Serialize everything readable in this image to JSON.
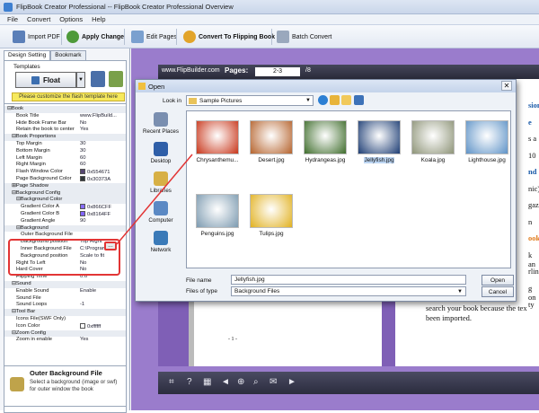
{
  "window": {
    "title": "FlipBook Creator Professional -- FlipBook Creator Professional Overview"
  },
  "menu": [
    "File",
    "Convert",
    "Options",
    "Help"
  ],
  "toolbar": {
    "import": "Import PDF",
    "apply": "Apply Change",
    "edit": "Edit Pages",
    "convert": "Convert To Flipping Book",
    "batch": "Batch Convert"
  },
  "left": {
    "tabs": [
      "Design Setting",
      "Bookmark"
    ],
    "templates_label": "Templates",
    "template_name": "Float",
    "customize_hint": "Please customize the flash template here"
  },
  "props": [
    {
      "k": "⊟Book",
      "v": "",
      "cat": true,
      "ind": 0
    },
    {
      "k": "Book Title",
      "v": "www.FlipBuild...",
      "ind": 2
    },
    {
      "k": "Hide Book Frame Bar",
      "v": "No",
      "ind": 2
    },
    {
      "k": "Retain the book to center",
      "v": "Yes",
      "ind": 2
    },
    {
      "k": "⊟Book Proportions",
      "v": "",
      "cat": true,
      "ind": 1
    },
    {
      "k": "Top Margin",
      "v": "30",
      "ind": 2
    },
    {
      "k": "Bottom Margin",
      "v": "30",
      "ind": 2
    },
    {
      "k": "Left Margin",
      "v": "60",
      "ind": 2
    },
    {
      "k": "Right Margin",
      "v": "60",
      "ind": 2
    },
    {
      "k": "Flash Window Color",
      "v": "0x554671",
      "sw": "#554671",
      "ind": 2
    },
    {
      "k": "Page Background Color",
      "v": "0x30373A",
      "sw": "#30373a",
      "ind": 2
    },
    {
      "k": "⊞Page Shadow",
      "v": "",
      "cat": true,
      "ind": 1
    },
    {
      "k": "⊟Background Config",
      "v": "",
      "cat": true,
      "ind": 1
    },
    {
      "k": "⊟Background Color",
      "v": "",
      "cat": true,
      "ind": 2
    },
    {
      "k": "Gradient Color A",
      "v": "0x866CFF",
      "sw": "#866cff",
      "ind": 3
    },
    {
      "k": "Gradient Color B",
      "v": "0x8164FF",
      "sw": "#8164ff",
      "ind": 3
    },
    {
      "k": "Gradient Angle",
      "v": "90",
      "ind": 3
    },
    {
      "k": "⊟Background",
      "v": "",
      "cat": true,
      "ind": 2
    },
    {
      "k": "Outer Background File",
      "v": "",
      "ind": 3
    },
    {
      "k": "Background position",
      "v": "Top Right",
      "ind": 3
    },
    {
      "k": "Inner Background File",
      "v": "C:\\Program ...",
      "ind": 3
    },
    {
      "k": "Background position",
      "v": "Scale to fit",
      "ind": 3
    },
    {
      "k": "Right To Left",
      "v": "No",
      "ind": 2
    },
    {
      "k": "Hard Cover",
      "v": "No",
      "ind": 2
    },
    {
      "k": "Flipping Time",
      "v": "0.6",
      "ind": 2
    },
    {
      "k": "⊟Sound",
      "v": "",
      "cat": true,
      "ind": 1
    },
    {
      "k": "Enable Sound",
      "v": "Enable",
      "ind": 2
    },
    {
      "k": "Sound File",
      "v": "",
      "ind": 2
    },
    {
      "k": "Sound Loops",
      "v": "-1",
      "ind": 2
    },
    {
      "k": "⊟Tool Bar",
      "v": "",
      "cat": true,
      "ind": 1
    },
    {
      "k": "Icons File(SWF Only)",
      "v": "",
      "ind": 2
    },
    {
      "k": "Icon Color",
      "v": "0xffffff",
      "sw": "#ffffff",
      "ind": 2
    },
    {
      "k": "⊟Zoom Config",
      "v": "",
      "cat": true,
      "ind": 1
    },
    {
      "k": "Zoom in enable",
      "v": "Yes",
      "ind": 2
    }
  ],
  "desc": {
    "title": "Outer Background File",
    "text": "Select a background (image or swf) for outer window the book"
  },
  "book": {
    "site": "www.FlipBuilder.com",
    "pages_label": "Pages:",
    "pages_value": "2-3",
    "total": "/8",
    "left_page_num": "- 1 -",
    "right_text_lines": [
      {
        "t": "sion",
        "c": "#1a5aa8"
      },
      {
        "t": "e",
        "c": "#1a5aa8"
      },
      {
        "t": "s a",
        "c": "#111"
      },
      {
        "t": "10",
        "c": "#111"
      },
      {
        "t": "nd",
        "c": "#1a5aa8"
      },
      {
        "t": "nic)",
        "c": "#111"
      },
      {
        "t": "gazi",
        "c": "#111"
      },
      {
        "t": "n",
        "c": "#111"
      },
      {
        "t": "ook",
        "c": "#e07a1a"
      },
      {
        "t": "k an",
        "c": "#111"
      },
      {
        "t": "rlin",
        "c": "#111"
      },
      {
        "t": "g on",
        "c": "#111"
      },
      {
        "t": "ty",
        "c": "#111"
      },
      {
        "t": "search your book because the tex",
        "c": "#111"
      },
      {
        "t": "been imported.",
        "c": "#111"
      }
    ]
  },
  "dialog": {
    "title": "Open",
    "look_in_label": "Look in",
    "look_in_value": "Sample Pictures",
    "places": [
      "Recent Places",
      "Desktop",
      "Libraries",
      "Computer",
      "Network"
    ],
    "files": [
      {
        "name": "Chrysanthemu...",
        "color": "#c8361a",
        "sel": false
      },
      {
        "name": "Desert.jpg",
        "color": "#b5632d",
        "sel": false
      },
      {
        "name": "Hydrangeas.jpg",
        "color": "#3f6d2c",
        "sel": false
      },
      {
        "name": "Jellyfish.jpg",
        "color": "#1d3d74",
        "sel": true
      },
      {
        "name": "Koala.jpg",
        "color": "#8e9478",
        "sel": false
      },
      {
        "name": "Lighthouse.jpg",
        "color": "#5f93c7",
        "sel": false
      },
      {
        "name": "Penguins.jpg",
        "color": "#7c9ab0",
        "sel": false
      },
      {
        "name": "Tulips.jpg",
        "color": "#e1b120",
        "sel": false
      }
    ],
    "file_name_label": "File name",
    "file_name_value": "Jellyfish.jpg",
    "file_type_label": "Files of type",
    "file_type_value": "Background Files",
    "open_btn": "Open",
    "cancel_btn": "Cancel"
  },
  "colors": {
    "annotation": "#e23535",
    "stage": "#9a7ccc",
    "selection": "#bcd5f2"
  }
}
